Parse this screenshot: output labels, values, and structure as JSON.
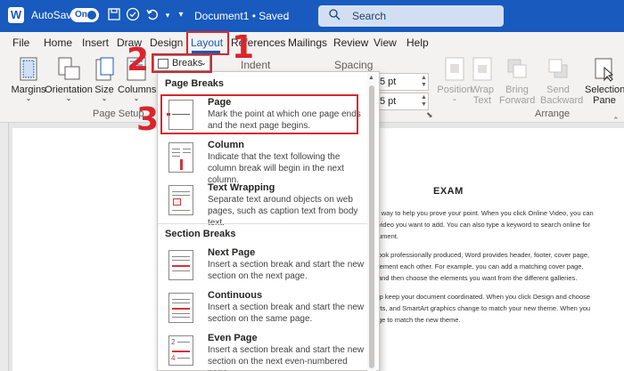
{
  "titlebar": {
    "autosave_label": "AutoSave",
    "autosave_state": "On",
    "doc_title": "Document1 • Saved",
    "search_placeholder": "Search"
  },
  "tabs": [
    {
      "label": "File"
    },
    {
      "label": "Home"
    },
    {
      "label": "Insert"
    },
    {
      "label": "Draw"
    },
    {
      "label": "Design"
    },
    {
      "label": "Layout"
    },
    {
      "label": "References"
    },
    {
      "label": "Mailings"
    },
    {
      "label": "Review"
    },
    {
      "label": "View"
    },
    {
      "label": "Help"
    }
  ],
  "ribbon": {
    "margins": "Margins",
    "orientation": "Orientation",
    "size": "Size",
    "columns": "Columns",
    "breaks": "Breaks",
    "indent": "Indent",
    "spacing": "Spacing",
    "spacing_before": "5 pt",
    "spacing_after": "5 pt",
    "position": "Position",
    "wrap_text": "Wrap Text",
    "bring_forward": "Bring Forward",
    "send_backward": "Send Backward",
    "selection_pane": "Selection Pane",
    "page_setup_label": "Page Setup",
    "arrange_label": "Arrange"
  },
  "dropdown": {
    "page_breaks_heading": "Page Breaks",
    "section_breaks_heading": "Section Breaks",
    "items": [
      {
        "title": "Page",
        "desc": "Mark the point at which one page ends and the next page begins."
      },
      {
        "title": "Column",
        "desc": "Indicate that the text following the column break will begin in the next column."
      },
      {
        "title": "Text Wrapping",
        "desc": "Separate text around objects on web pages, such as caption text from body text."
      },
      {
        "title": "Next Page",
        "desc": "Insert a section break and start the new section on the next page."
      },
      {
        "title": "Continuous",
        "desc": "Insert a section break and start the new section on the same page."
      },
      {
        "title": "Even Page",
        "desc": "Insert a section break and start the new section on the next even-numbered page."
      }
    ]
  },
  "document": {
    "heading": "EXAM",
    "paragraphs": [
      "l way to help you prove your point. When you click Online Video, you can",
      "video you want to add. You can also type a keyword to search online for",
      "ument.",
      "ook professionally produced, Word provides header, footer, cover page,",
      "lement each other. For example, you can add a matching cover page,",
      "and then choose the elements you want from the different galleries.",
      "lp keep your document coordinated. When you click Design and choose",
      "rts, and SmartArt graphics change to match your new theme. When you",
      "ge to match the new theme."
    ]
  },
  "annotations": [
    "1",
    "2",
    "3"
  ],
  "colors": {
    "accent": "#185abd",
    "annotation": "#d8262c"
  }
}
